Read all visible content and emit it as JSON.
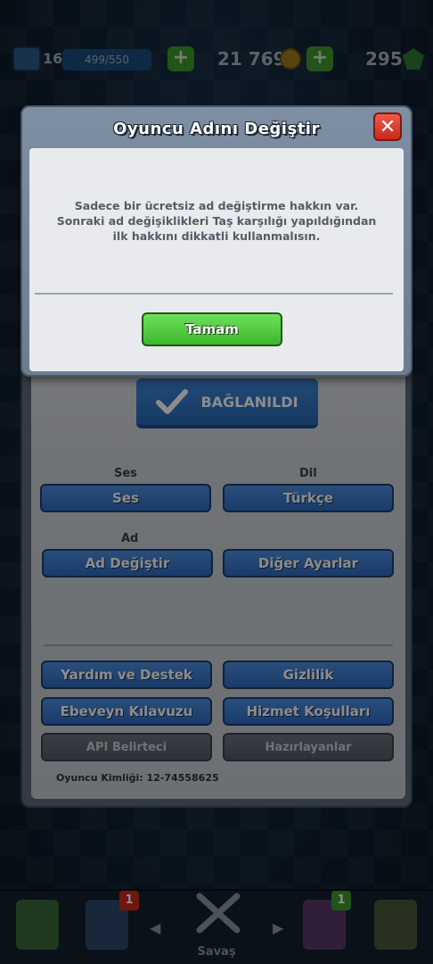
{
  "topbar": {
    "level": "16",
    "xp": "499/550",
    "gold": "21 769",
    "gems": "295",
    "plus": "+"
  },
  "settings": {
    "connected_label": "BAĞLANILDI",
    "sound_section": "Ses",
    "language_section": "Dil",
    "name_section": "Ad",
    "sound_button": "Ses",
    "language_button": "Türkçe",
    "change_name_button": "Ad Değiştir",
    "other_settings_button": "Diğer Ayarlar",
    "help_button": "Yardım ve Destek",
    "privacy_button": "Gizlilik",
    "parent_guide_button": "Ebeveyn Kılavuzu",
    "terms_button": "Hizmet Koşulları",
    "api_button": "API Belirteci",
    "credits_button": "Hazırlayanlar",
    "player_id": "Oyuncu Kimliği: 12-74558625"
  },
  "modal": {
    "title": "Oyuncu Adını Değiştir",
    "close": "✕",
    "message": "Sadece bir ücretsiz ad değiştirme hakkın var. Sonraki ad değişiklikleri Taş karşılığı yapıldığından ilk hakkını dikkatli kullanmalısın.",
    "ok_button": "Tamam"
  },
  "bottom_nav": {
    "battle_label": "Savaş",
    "cards_notif": "1",
    "clan_notif": "1",
    "left_arrow": "◀",
    "right_arrow": "▶"
  },
  "colors": {
    "primary_blue": "#2f6cc2",
    "ok_green": "#3eb62e",
    "close_red": "#c8291d"
  }
}
